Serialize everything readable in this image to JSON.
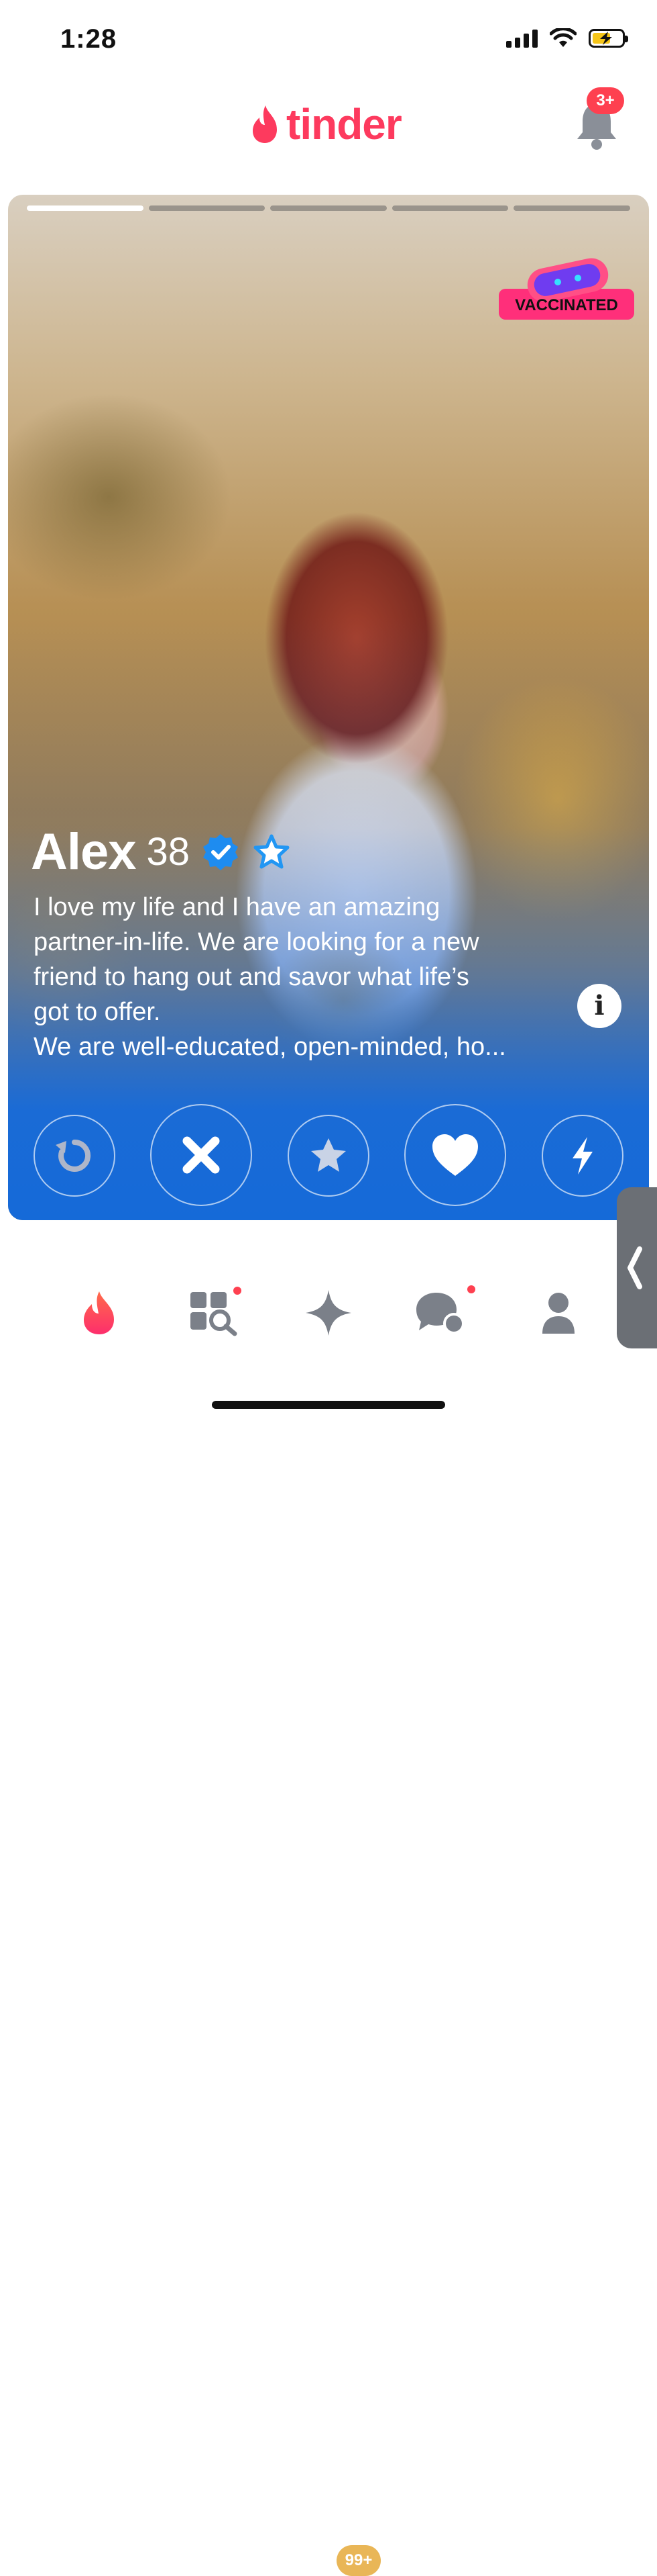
{
  "status_bar": {
    "time": "1:28"
  },
  "header": {
    "logo_text": "tinder",
    "notification_badge": "3+"
  },
  "card": {
    "photo_count": 5,
    "active_photo_index": 0,
    "vaccinated_badge": "VACCINATED",
    "name": "Alex",
    "age": "38",
    "verified": true,
    "super_like_star": true,
    "bio": "I love my life and I have an amazing\npartner-in-life. We are looking for a new\nfriend to hang out and savor what life’s\ngot to offer.\nWe are well-educated, open-minded, ho...",
    "info_label": "i"
  },
  "actions": [
    {
      "name": "rewind",
      "icon": "rewind-icon"
    },
    {
      "name": "nope",
      "icon": "close-icon"
    },
    {
      "name": "super-like",
      "icon": "star-icon"
    },
    {
      "name": "like",
      "icon": "heart-icon"
    },
    {
      "name": "boost",
      "icon": "bolt-icon"
    }
  ],
  "bottom_nav": {
    "items": [
      {
        "name": "home",
        "icon": "flame-icon",
        "active": true
      },
      {
        "name": "explore",
        "icon": "explore-icon",
        "dot": true
      },
      {
        "name": "gold",
        "icon": "sparkle-icon",
        "badge": "99+"
      },
      {
        "name": "messages",
        "icon": "chat-icon",
        "dot": true
      },
      {
        "name": "profile",
        "icon": "person-icon"
      }
    ]
  },
  "colors": {
    "brand": "#fd3a5e",
    "card_blue": "#156ad8",
    "icon_gray": "#7b8089",
    "gold": "#e9b657"
  }
}
